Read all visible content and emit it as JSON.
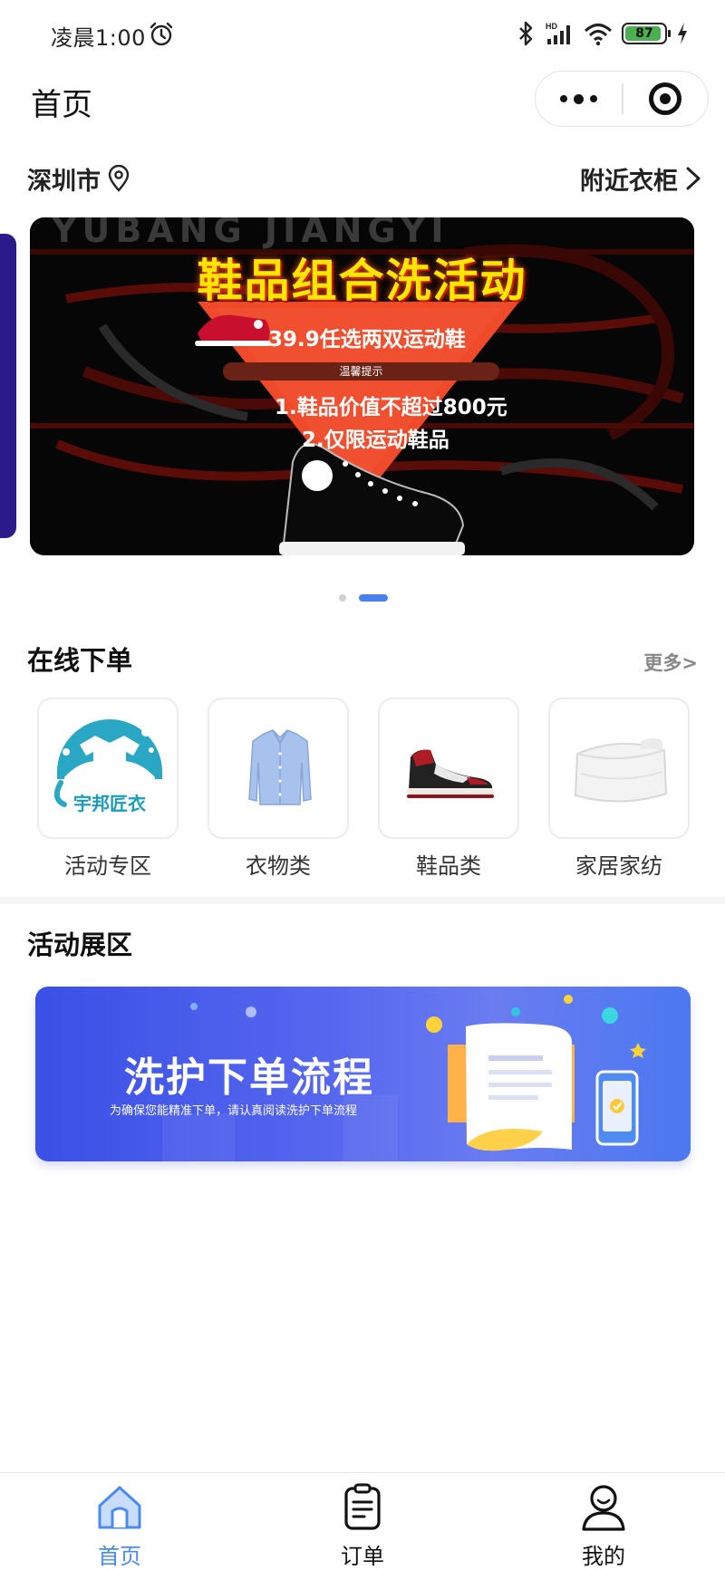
{
  "status_bar": {
    "time": "凌晨1:00",
    "network": "HD",
    "battery": "87"
  },
  "nav": {
    "title": "首页"
  },
  "location": {
    "city": "深圳市",
    "nearby_label": "附近衣柜"
  },
  "banner": {
    "watermark": "YUBANG JIANGYI",
    "title": "鞋品组合洗活动",
    "line1": "39.9任选两双运动鞋",
    "tip": "温馨提示",
    "line2": "1.鞋品价值不超过800元",
    "line3": "2.仅限运动鞋品",
    "slide_count": 2,
    "active_slide": 2
  },
  "online_order": {
    "title": "在线下单",
    "more_label": "更多>",
    "categories": [
      {
        "label": "活动专区",
        "logo_text": "宇邦匠衣",
        "icon": "brand-logo-icon"
      },
      {
        "label": "衣物类",
        "icon": "shirt-icon"
      },
      {
        "label": "鞋品类",
        "icon": "sneaker-icon"
      },
      {
        "label": "家居家纺",
        "icon": "duvet-icon"
      }
    ]
  },
  "activity": {
    "title": "活动展区",
    "promo_title": "洗护下单流程",
    "promo_subtitle": "为确保您能精准下单，请认真阅读洗护下单流程"
  },
  "tabbar": {
    "items": [
      {
        "label": "首页",
        "icon": "home-icon",
        "active": true
      },
      {
        "label": "订单",
        "icon": "order-icon",
        "active": false
      },
      {
        "label": "我的",
        "icon": "profile-icon",
        "active": false
      }
    ]
  },
  "colors": {
    "accent": "#4a8af4",
    "banner_title": "#ffe600",
    "promo_blue": "#3a50e6"
  }
}
